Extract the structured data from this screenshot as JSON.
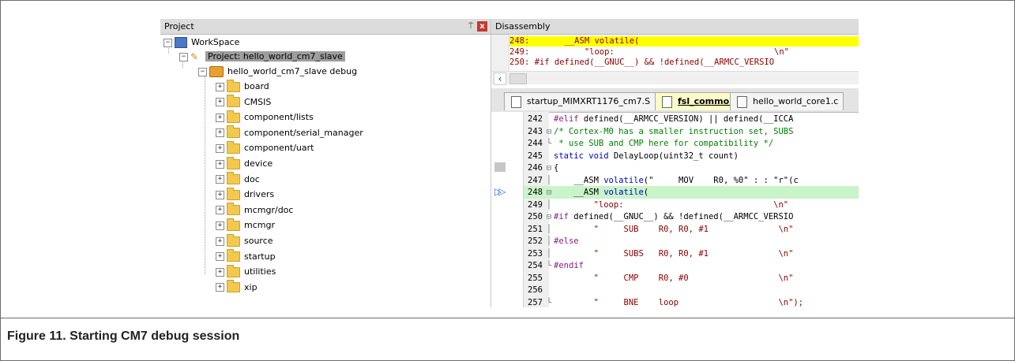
{
  "project_pane": {
    "title": "Project",
    "pin_glyph": "⍑",
    "close_glyph": "x",
    "tree": {
      "workspace": "WorkSpace",
      "project": "Project: hello_world_cm7_slave",
      "target": "hello_world_cm7_slave debug",
      "folders": [
        "board",
        "CMSIS",
        "component/lists",
        "component/serial_manager",
        "component/uart",
        "device",
        "doc",
        "drivers",
        "mcmgr/doc",
        "mcmgr",
        "source",
        "startup",
        "utilities",
        "xip"
      ]
    }
  },
  "disassembly": {
    "title": "Disassembly",
    "lines": [
      {
        "text": "248:       __ASM volatile(",
        "highlight": true
      },
      {
        "text": "249:           \"loop:                                \\n\"",
        "highlight": false
      },
      {
        "text": "250: #if defined(__GNUC__) && !defined(__ARMCC_VERSIO",
        "highlight": false
      }
    ]
  },
  "editor": {
    "tabs": [
      {
        "label": "startup_MIMXRT1176_cm7.S",
        "active": false
      },
      {
        "label": "fsl_common.c",
        "active": true
      },
      {
        "label": "hello_world_core1.c",
        "active": false
      }
    ],
    "current_line": 248,
    "lines": [
      {
        "num": "242",
        "fold": "",
        "tokens": [
          {
            "t": "#elif",
            "c": "pp"
          },
          {
            "t": " defined(__ARMCC_VERSION) || defined(__ICCA",
            "c": "nm"
          }
        ]
      },
      {
        "num": "243",
        "fold": "⊟",
        "tokens": [
          {
            "t": "/* Cortex-M0 has a smaller instruction set, SUBS",
            "c": "cm"
          }
        ]
      },
      {
        "num": "244",
        "fold": "└",
        "tokens": [
          {
            "t": " * use SUB and CMP here for compatibility */",
            "c": "cm"
          }
        ]
      },
      {
        "num": "245",
        "fold": "",
        "tokens": [
          {
            "t": "static",
            "c": "kw"
          },
          {
            "t": " ",
            "c": "nm"
          },
          {
            "t": "void",
            "c": "kw"
          },
          {
            "t": " DelayLoop(uint32_t count)",
            "c": "nm"
          }
        ]
      },
      {
        "num": "246",
        "fold": "⊟",
        "tokens": [
          {
            "t": "{",
            "c": "nm"
          }
        ]
      },
      {
        "num": "247",
        "fold": "│",
        "tokens": [
          {
            "t": "    __ASM ",
            "c": "nm"
          },
          {
            "t": "volatile",
            "c": "kw"
          },
          {
            "t": "(\"     MOV    R0, %0\" : : \"r\"(c",
            "c": "nm"
          }
        ]
      },
      {
        "num": "248",
        "fold": "⊟",
        "tokens": [
          {
            "t": "    __ASM ",
            "c": "nm"
          },
          {
            "t": "volatile",
            "c": "kw"
          },
          {
            "t": "(",
            "c": "nm"
          }
        ]
      },
      {
        "num": "249",
        "fold": "│",
        "tokens": [
          {
            "t": "        \"loop:                              \\n\"",
            "c": "st"
          }
        ]
      },
      {
        "num": "250",
        "fold": "⊟",
        "tokens": [
          {
            "t": "#if",
            "c": "pp"
          },
          {
            "t": " defined(__GNUC__) && !defined(__ARMCC_VERSIO",
            "c": "nm"
          }
        ]
      },
      {
        "num": "251",
        "fold": "│",
        "tokens": [
          {
            "t": "        \"     SUB    R0, R0, #1              \\n\"",
            "c": "st"
          }
        ]
      },
      {
        "num": "252",
        "fold": "│",
        "tokens": [
          {
            "t": "#else",
            "c": "pp"
          }
        ]
      },
      {
        "num": "253",
        "fold": "│",
        "tokens": [
          {
            "t": "        \"     SUBS   R0, R0, #1              \\n\"",
            "c": "st"
          }
        ]
      },
      {
        "num": "254",
        "fold": "└",
        "tokens": [
          {
            "t": "#endif",
            "c": "pp"
          }
        ]
      },
      {
        "num": "255",
        "fold": "",
        "tokens": [
          {
            "t": "        \"     CMP    R0, #0                  \\n\"",
            "c": "st"
          }
        ]
      },
      {
        "num": "256",
        "fold": "",
        "tokens": [
          {
            "t": "",
            "c": "nm"
          }
        ]
      },
      {
        "num": "257",
        "fold": "└",
        "tokens": [
          {
            "t": "        \"     BNE    loop                    \\n\");",
            "c": "st"
          }
        ]
      }
    ]
  },
  "caption": "Figure 11.  Starting CM7 debug session"
}
